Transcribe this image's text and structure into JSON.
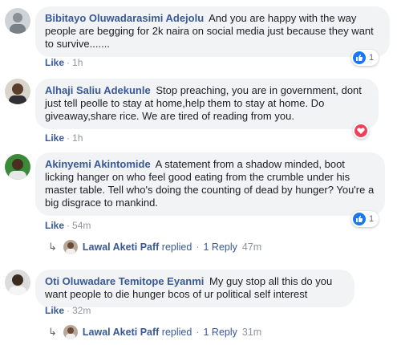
{
  "comments": [
    {
      "author": "Bibitayo Oluwadarasimi Adejolu",
      "text": "And you are happy with the way people are begging for 2k naira on social media just because they want to survive.......",
      "like_label": "Like",
      "time": "1h",
      "reaction": {
        "type": "like-icon",
        "count": "1",
        "color": "#1877f2"
      }
    },
    {
      "author": "Alhaji Saliu Adekunle",
      "text": "Stop preaching, you are in government, dont just tell peolle to stay at home,help them to stay at home. Do giveaway,share rice. We are tired of reading from you.",
      "like_label": "Like",
      "time": "1h",
      "reaction": {
        "type": "love-icon",
        "count": "",
        "color": "#f33e58"
      }
    },
    {
      "author": "Akinyemi Akintomide",
      "text": "A statement from a shadow minded, boot licking hanger on who feel good eating from the crumble under his master table. Tell who's doing the counting of dead by hunger? You're a big disgrace to mankind.",
      "like_label": "Like",
      "time": "54m",
      "reaction": {
        "type": "like-icon",
        "count": "1",
        "color": "#1877f2"
      },
      "reply": {
        "name": "Lawal Aketi Paff",
        "action": "replied",
        "count_label": "1 Reply",
        "time": "47m"
      }
    },
    {
      "author": "Oti Oluwadare Temitope Eyanmi",
      "text": "My guy stop all this do you want people to die hunger bcos of ur political self interest",
      "like_label": "Like",
      "time": "32m",
      "reply": {
        "name": "Lawal Aketi Paff",
        "action": "replied",
        "count_label": "1 Reply",
        "time": "31m"
      }
    }
  ],
  "colors": {
    "link": "#385898",
    "bubble": "#f2f3f5",
    "muted": "#90949c"
  }
}
